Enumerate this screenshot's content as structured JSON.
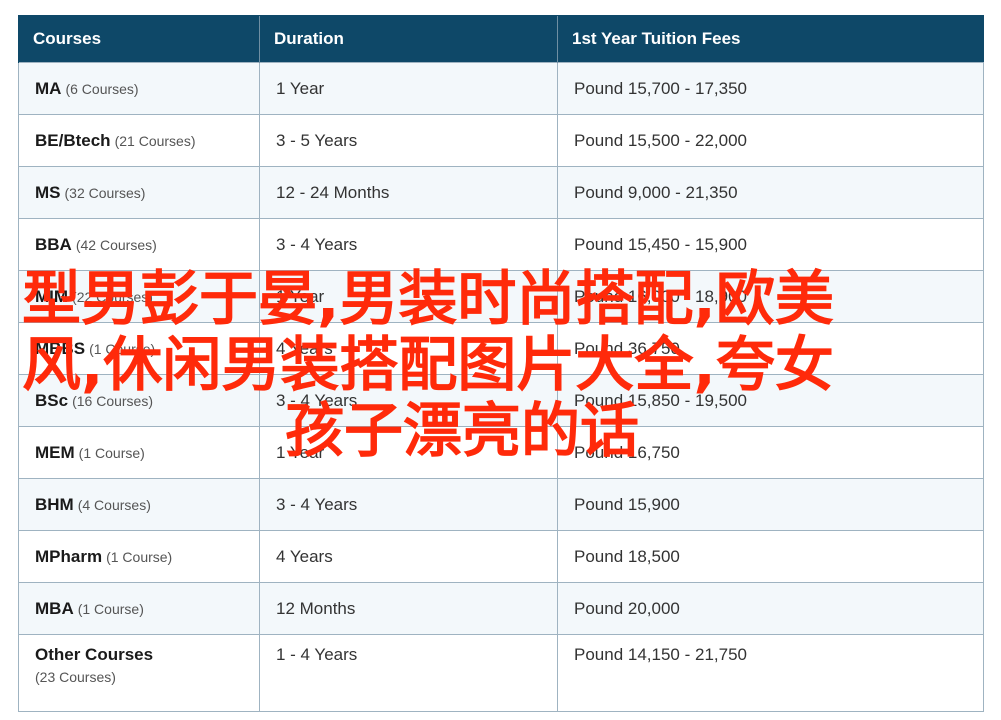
{
  "table": {
    "headers": [
      "Courses",
      "Duration",
      "1st Year Tuition Fees"
    ],
    "rows": [
      {
        "name": "MA",
        "count": "(6 Courses)",
        "duration": "1 Year",
        "fees": "Pound 15,700 - 17,350"
      },
      {
        "name": "BE/Btech",
        "count": "(21 Courses)",
        "duration": "3 - 5 Years",
        "fees": "Pound 15,500 - 22,000"
      },
      {
        "name": "MS",
        "count": "(32 Courses)",
        "duration": "12 - 24 Months",
        "fees": "Pound 9,000 - 21,350"
      },
      {
        "name": "BBA",
        "count": "(42 Courses)",
        "duration": "3 - 4 Years",
        "fees": "Pound 15,450 - 15,900"
      },
      {
        "name": "MIM",
        "count": "(22 Courses)",
        "duration": "1 Year",
        "fees": "Pound 16,000 - 18,900"
      },
      {
        "name": "MBBS",
        "count": "(1 Course)",
        "duration": "4 Years",
        "fees": "Pound 36,750"
      },
      {
        "name": "BSc",
        "count": "(16 Courses)",
        "duration": "3 - 4 Years",
        "fees": "Pound 15,850 - 19,500"
      },
      {
        "name": "MEM",
        "count": "(1 Course)",
        "duration": "1 Year",
        "fees": "Pound 16,750"
      },
      {
        "name": "BHM",
        "count": "(4 Courses)",
        "duration": "3 - 4 Years",
        "fees": "Pound 15,900"
      },
      {
        "name": "MPharm",
        "count": "(1 Course)",
        "duration": "4 Years",
        "fees": "Pound 18,500"
      },
      {
        "name": "MBA",
        "count": "(1 Course)",
        "duration": "12 Months",
        "fees": "Pound 20,000"
      },
      {
        "name": "Other Courses",
        "count": "(23 Courses)",
        "duration": "1 - 4 Years",
        "fees": "Pound 14,150 - 21,750"
      }
    ]
  },
  "overlay": {
    "line1": "型男彭于晏,男装时尚搭配,欧美",
    "line2": "风,休闲男装搭配图片大全,夸女",
    "line3": "孩子漂亮的话",
    "color": "#ff2a0a"
  },
  "colors": {
    "header_bg": "#0e4868",
    "row_alt_bg": "#f3f8fb",
    "border": "#9fb3c1"
  }
}
